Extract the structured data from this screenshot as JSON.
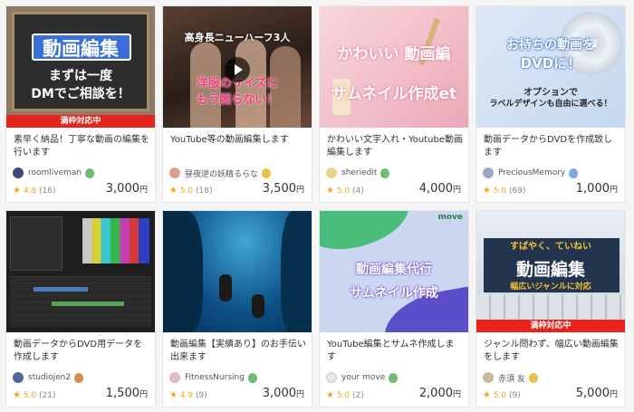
{
  "badge_label": "満枠対応中",
  "cards": [
    {
      "thumb_lines": [
        "動画編集",
        "まずは一度",
        "DMでご相談を！"
      ],
      "badge": true,
      "title": "素早く納品！丁寧な動画の編集を行います",
      "seller": "roomliveman",
      "rank_color": "#6fbf73",
      "rating": "4.8",
      "reviews": "(16)",
      "price": "3,000",
      "yen": "円"
    },
    {
      "thumb_lines": [
        "高身長ニューハーフ3人",
        "洋服のサイズに",
        "もう困らない！"
      ],
      "badge": false,
      "title": "YouTube等の動画編集します",
      "seller": "昼夜逆の妖精るらな",
      "rank_color": "#e8c14a",
      "rating": "5.0",
      "reviews": "(18)",
      "price": "3,500",
      "yen": "円"
    },
    {
      "thumb_lines": [
        "かわいい 動画編",
        "サムネイル作成et"
      ],
      "badge": false,
      "title": "かわいい文字入れ・Youtube動画編集します",
      "seller": "sheriedit",
      "rank_color": "#6fbf73",
      "rating": "5.0",
      "reviews": "(4)",
      "price": "4,000",
      "yen": "円"
    },
    {
      "thumb_lines": [
        "お持ちの動画を",
        "DVDに！",
        "オプションで",
        "ラベルデザインも自由に選べる！"
      ],
      "badge": false,
      "title": "動画データからDVDを作成致します",
      "seller": "PreciousMemory",
      "rank_color": "#7fa7e0",
      "rating": "5.0",
      "reviews": "(69)",
      "price": "1,000",
      "yen": "円"
    },
    {
      "thumb_lines": [],
      "badge": false,
      "title": "動画データからDVD用データを作成します",
      "seller": "studiojen2",
      "rank_color": "#d98b4a",
      "rating": "5.0",
      "reviews": "(21)",
      "price": "1,500",
      "yen": "円"
    },
    {
      "thumb_lines": [],
      "badge": false,
      "title": "動画編集【実績あり】のお手伝い出来ます",
      "seller": "FitnessNursing",
      "rank_color": "#6fbf73",
      "rating": "4.9",
      "reviews": "(9)",
      "price": "3,000",
      "yen": "円"
    },
    {
      "thumb_lines": [
        "move",
        "動画編集代行",
        "サムネイル作成"
      ],
      "badge": false,
      "title": "YouTube編集とサムネ作成します",
      "seller": "your move",
      "rank_color": "#6fbf73",
      "rating": "5.0",
      "reviews": "(2)",
      "price": "2,000",
      "yen": "円"
    },
    {
      "thumb_lines": [
        "すばやく、ていねい",
        "動画編集",
        "幅広いジャンルに対応"
      ],
      "badge": true,
      "title": "ジャンル問わず、幅広い動画編集をします",
      "seller": "赤須 友",
      "rank_color": "#e8c14a",
      "rating": "5.0",
      "reviews": "(9)",
      "price": "5,000",
      "yen": "円"
    }
  ]
}
